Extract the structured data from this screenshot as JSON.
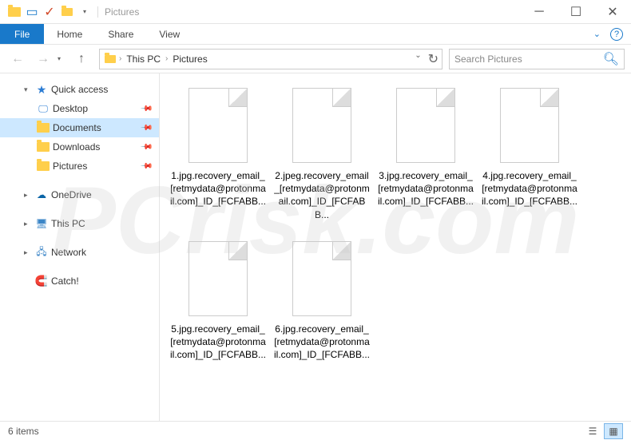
{
  "window": {
    "title": "Pictures"
  },
  "ribbon": {
    "file": "File",
    "tabs": [
      "Home",
      "Share",
      "View"
    ]
  },
  "breadcrumb": {
    "items": [
      "This PC",
      "Pictures"
    ]
  },
  "search": {
    "placeholder": "Search Pictures"
  },
  "sidebar": {
    "quick_access": "Quick access",
    "quick_items": [
      {
        "label": "Desktop",
        "pinned": true
      },
      {
        "label": "Documents",
        "pinned": true,
        "selected": true
      },
      {
        "label": "Downloads",
        "pinned": true
      },
      {
        "label": "Pictures",
        "pinned": true
      }
    ],
    "onedrive": "OneDrive",
    "thispc": "This PC",
    "network": "Network",
    "catch": "Catch!"
  },
  "files": [
    {
      "name": "1.jpg.recovery_email_[retmydata@protonmail.com]_ID_[FCFABB..."
    },
    {
      "name": "2.jpeg.recovery_email_[retmydata@protonmail.com]_ID_[FCFABB..."
    },
    {
      "name": "3.jpg.recovery_email_[retmydata@protonmail.com]_ID_[FCFABB..."
    },
    {
      "name": "4.jpg.recovery_email_[retmydata@protonmail.com]_ID_[FCFABB..."
    },
    {
      "name": "5.jpg.recovery_email_[retmydata@protonmail.com]_ID_[FCFABB..."
    },
    {
      "name": "6.jpg.recovery_email_[retmydata@protonmail.com]_ID_[FCFABB..."
    }
  ],
  "status": {
    "count": "6 items"
  }
}
